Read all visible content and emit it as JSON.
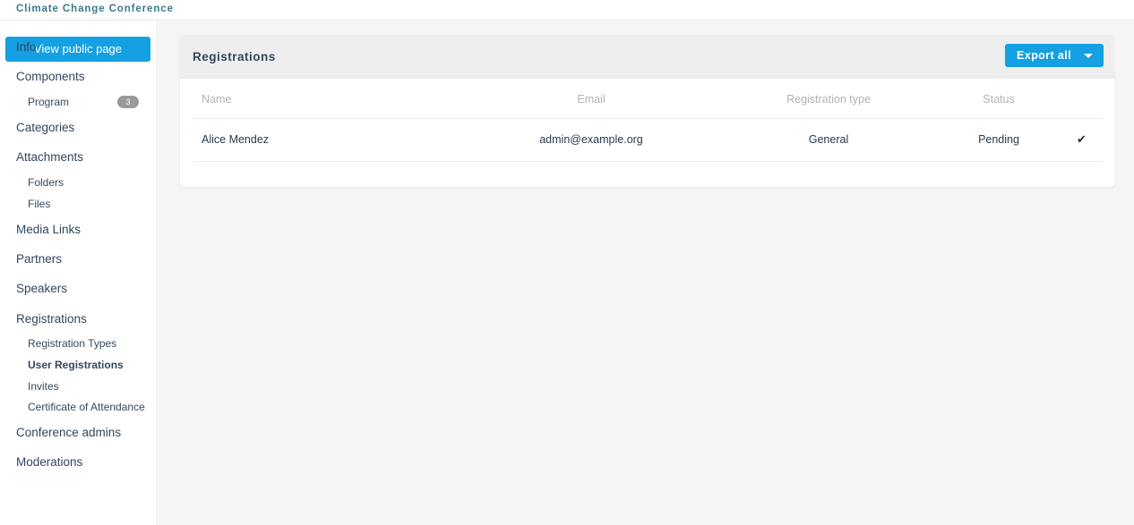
{
  "topbar": {
    "brand": "Climate Change Conference"
  },
  "sidebar": {
    "view_public_page_label": "View public page",
    "items": [
      {
        "label": "Info",
        "level": 0,
        "active": false,
        "badge": null
      },
      {
        "label": "Components",
        "level": 0,
        "active": false,
        "badge": null
      },
      {
        "label": "Program",
        "level": 1,
        "active": false,
        "badge": "3"
      },
      {
        "label": "Categories",
        "level": 0,
        "active": false,
        "badge": null
      },
      {
        "label": "Attachments",
        "level": 0,
        "active": false,
        "badge": null
      },
      {
        "label": "Folders",
        "level": 1,
        "active": false,
        "badge": null
      },
      {
        "label": "Files",
        "level": 1,
        "active": false,
        "badge": null
      },
      {
        "label": "Media Links",
        "level": 0,
        "active": false,
        "badge": null
      },
      {
        "label": "Partners",
        "level": 0,
        "active": false,
        "badge": null
      },
      {
        "label": "Speakers",
        "level": 0,
        "active": false,
        "badge": null
      },
      {
        "label": "Registrations",
        "level": 0,
        "active": false,
        "badge": null
      },
      {
        "label": "Registration Types",
        "level": 1,
        "active": false,
        "badge": null
      },
      {
        "label": "User Registrations",
        "level": 1,
        "active": true,
        "badge": null
      },
      {
        "label": "Invites",
        "level": 1,
        "active": false,
        "badge": null
      },
      {
        "label": "Certificate of Attendance",
        "level": 1,
        "active": false,
        "badge": null
      },
      {
        "label": "Conference admins",
        "level": 0,
        "active": false,
        "badge": null
      },
      {
        "label": "Moderations",
        "level": 0,
        "active": false,
        "badge": null
      }
    ]
  },
  "card": {
    "title": "Registrations",
    "export_label": "Export all",
    "export_caret_icon": "chevron-down-icon"
  },
  "table": {
    "columns": [
      "Name",
      "Email",
      "Registration type",
      "Status",
      ""
    ],
    "rows": [
      {
        "name": "Alice Mendez",
        "email": "admin@example.org",
        "registration_type": "General",
        "status": "Pending",
        "action_icon": "check-icon",
        "action_glyph": "✔"
      }
    ]
  },
  "colors": {
    "accent": "#14a0e2",
    "brand_text": "#3b7a8c",
    "card_header_bg": "#eeeeee",
    "page_bg": "#f5f5f5",
    "badge_bg": "#9a9a9a"
  }
}
